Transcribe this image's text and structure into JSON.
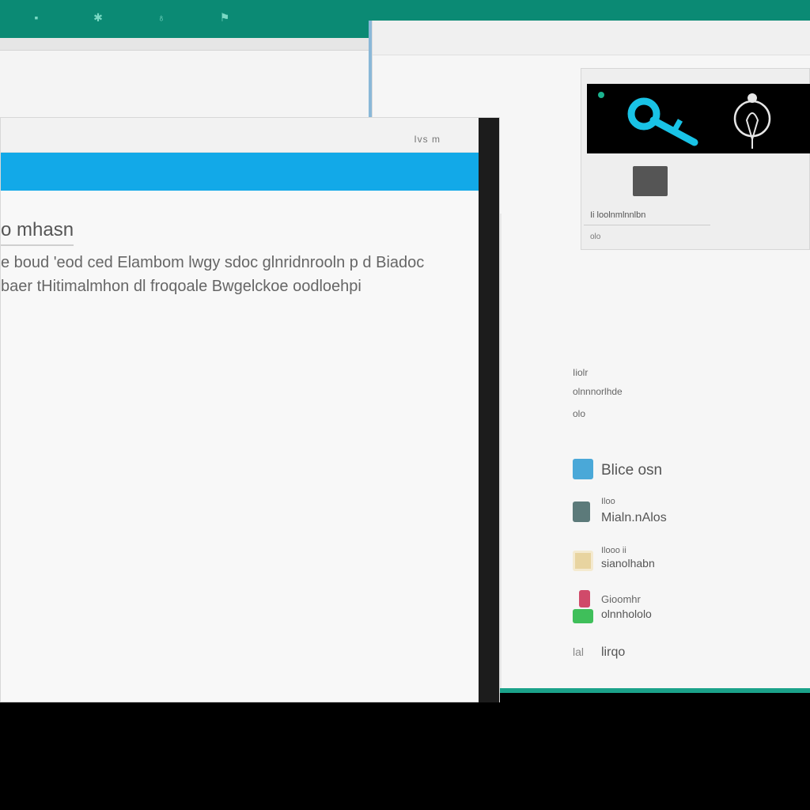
{
  "colors": {
    "desktop_bar": "#0b8a74",
    "banner": "#12a9e8",
    "window_bg": "#f8f8f8",
    "frame_dark": "#1c1c1c",
    "accent_key": "#19c3e6"
  },
  "topbar": {
    "icons": [
      "pin-icon",
      "star-icon",
      "gear-icon",
      "flag-icon"
    ]
  },
  "main": {
    "controls": "Ivs  m",
    "heading": "o mhasn",
    "paragraph": "e boud 'eod ced Elambom lwgy sdoc glnridnrooln p d Biadoc baer tHitimalmhon dl froqoale Bwgelckoe oodloehpi"
  },
  "preview": {
    "caption": "Ii loolnmlnnlbn",
    "subcaption": "olo"
  },
  "side": {
    "small_1": "Iiolr",
    "small_2": "olnnnorlhde",
    "small_3": "olo",
    "apps": [
      {
        "label": "Blice osn",
        "icon": "chart-icon",
        "icon_color": "#4aa8d8"
      },
      {
        "label_top": "Iloo",
        "label": "Mialn.nAlos",
        "icon": "tool-icon",
        "icon_color": "#5c7a7a"
      },
      {
        "label_top": "Ilooo ii",
        "label": "sianolhabn",
        "icon": "box-icon",
        "icon_color": "#e8d4a0"
      },
      {
        "label_top": "Gioomhr",
        "label": "olnnhololo",
        "icon": "plant-icon",
        "icon_color": "#d04a6a"
      },
      {
        "label_top": "lal",
        "label": "lirqo",
        "icon": "doc-icon",
        "icon_color": "#9a9a9a"
      }
    ]
  }
}
